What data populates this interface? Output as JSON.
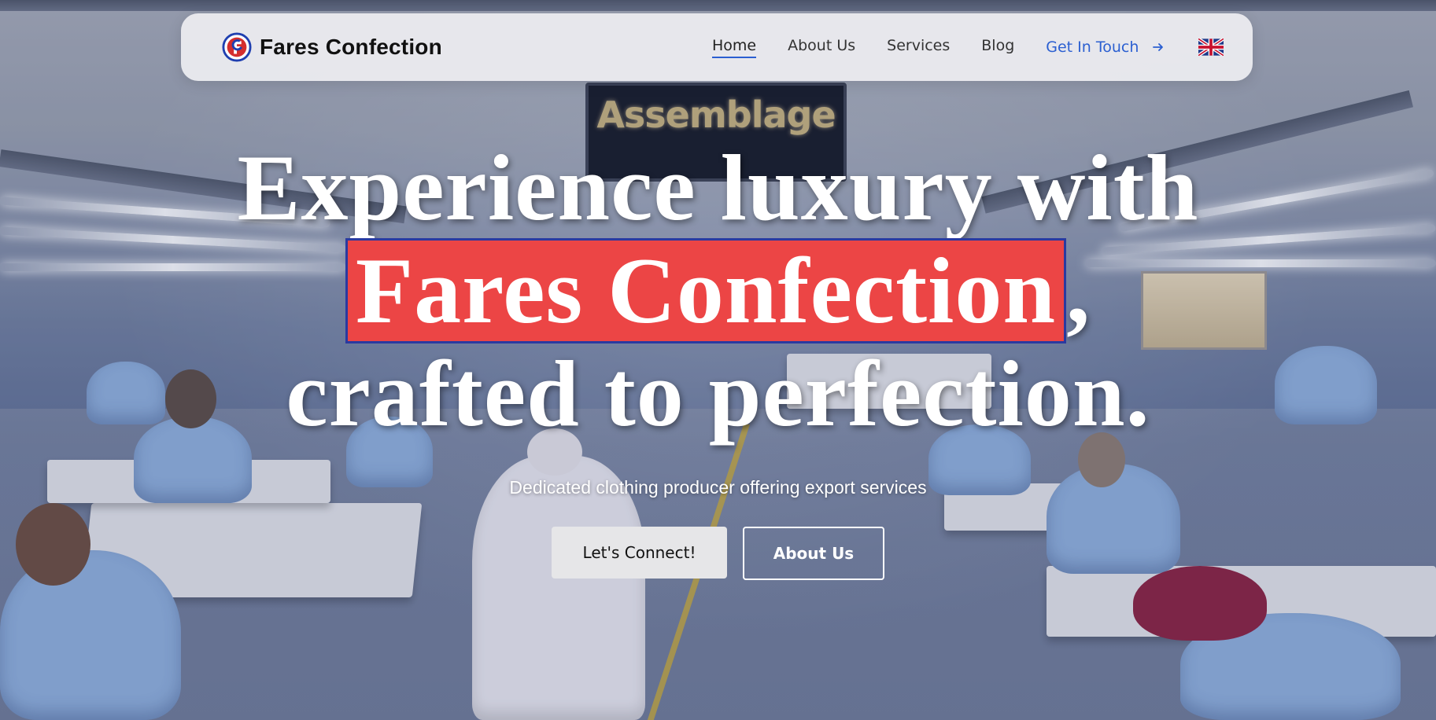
{
  "brand": {
    "name": "Fares Confection",
    "logo_icon": "fc-circle-logo-icon",
    "colors": {
      "red": "#d42e2e",
      "blue": "#1f3fb0"
    }
  },
  "nav": {
    "links": [
      {
        "label": "Home",
        "active": true
      },
      {
        "label": "About Us",
        "active": false
      },
      {
        "label": "Services",
        "active": false
      },
      {
        "label": "Blog",
        "active": false
      }
    ],
    "cta": {
      "label": "Get In Touch",
      "icon": "arrow-right-icon"
    },
    "language": {
      "icon": "uk-flag-icon"
    }
  },
  "hero": {
    "headline_line1": "Experience luxury with",
    "headline_highlight": "Fares Confection",
    "headline_comma": ",",
    "headline_line3": "crafted to perfection.",
    "subtitle": "Dedicated clothing producer offering export services",
    "primary_button": "Let's Connect!",
    "secondary_button": "About Us",
    "background_sign": "Assemblage",
    "accent_colors": {
      "highlight": "#ec4545",
      "highlight_border": "#2a3aa0",
      "link": "#2b5fd1"
    }
  }
}
